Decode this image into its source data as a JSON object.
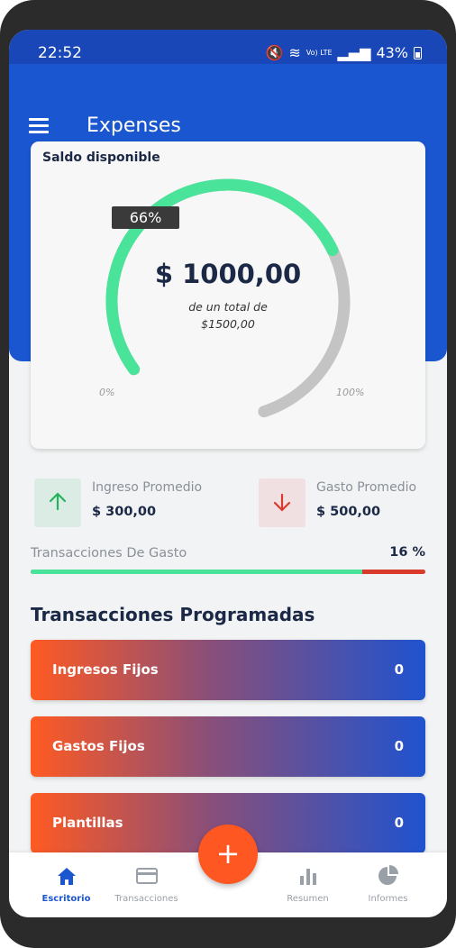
{
  "status_bar": {
    "time": "22:52",
    "signal": "Vo) LTE",
    "battery": "43%"
  },
  "app": {
    "title": "Expenses"
  },
  "balance": {
    "title": "Saldo disponible",
    "percent_label": "66%",
    "percent": 66,
    "amount": "$ 1000,00",
    "of_total_label": "de un total de",
    "total": "$1500,00",
    "scale_min": "0%",
    "scale_max": "100%"
  },
  "stats": {
    "income": {
      "label": "Ingreso Promedio",
      "value": "$ 300,00"
    },
    "expense": {
      "label": "Gasto Promedio",
      "value": "$ 500,00"
    }
  },
  "transactions": {
    "label": "Transacciones De Gasto",
    "percent_label": "16 %",
    "bar_percent": 84
  },
  "scheduled": {
    "title": "Transacciones Programadas",
    "items": [
      {
        "label": "Ingresos Fijos",
        "count": "0"
      },
      {
        "label": "Gastos Fijos",
        "count": "0"
      },
      {
        "label": "Plantillas",
        "count": "0"
      }
    ]
  },
  "nav": {
    "items": [
      {
        "label": "Escritorio",
        "icon": "home-icon"
      },
      {
        "label": "Transacciones",
        "icon": "card-icon"
      },
      {
        "label": "Resumen",
        "icon": "bar-chart-icon"
      },
      {
        "label": "Informes",
        "icon": "pie-chart-icon"
      }
    ],
    "fab_label": "+"
  },
  "colors": {
    "primary": "#1a56d0",
    "accent": "#ff5722",
    "gauge": "#4ae39a",
    "gauge_track": "#c4c4c4"
  }
}
